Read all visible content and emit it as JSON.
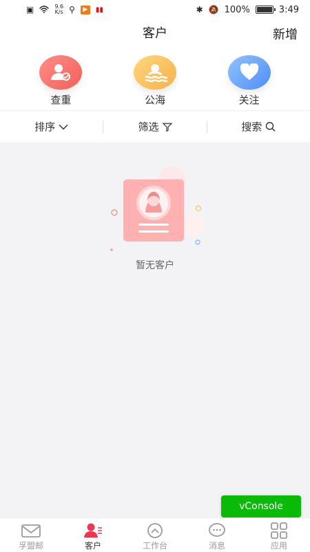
{
  "status_bar": {
    "network_speed_value": "9.6",
    "network_speed_unit": "K/s",
    "battery": "100%",
    "battery_level": 1.0,
    "time": "3:49"
  },
  "header": {
    "title": "客户",
    "new_label": "新增"
  },
  "quick_actions": [
    {
      "label": "查重",
      "icon": "user-check-icon",
      "color": "#f25f5c"
    },
    {
      "label": "公海",
      "icon": "sea-person-icon",
      "color": "#f6b14a"
    },
    {
      "label": "关注",
      "icon": "heart-icon",
      "color": "#4f8df6"
    }
  ],
  "filters": {
    "sort_label": "排序",
    "filter_label": "筛选",
    "search_label": "搜索"
  },
  "empty_state": {
    "text": "暂无客户"
  },
  "vconsole": {
    "label": "vConsole"
  },
  "tabs": [
    {
      "label": "孚盟邮",
      "icon": "mail-icon",
      "active": false
    },
    {
      "label": "客户",
      "icon": "customer-icon",
      "active": true
    },
    {
      "label": "工作台",
      "icon": "workbench-icon",
      "active": false
    },
    {
      "label": "消息",
      "icon": "message-icon",
      "active": false
    },
    {
      "label": "应用",
      "icon": "apps-icon",
      "active": false
    }
  ],
  "colors": {
    "accent": "#f25f5c",
    "vconsole_green": "#09bb07"
  }
}
